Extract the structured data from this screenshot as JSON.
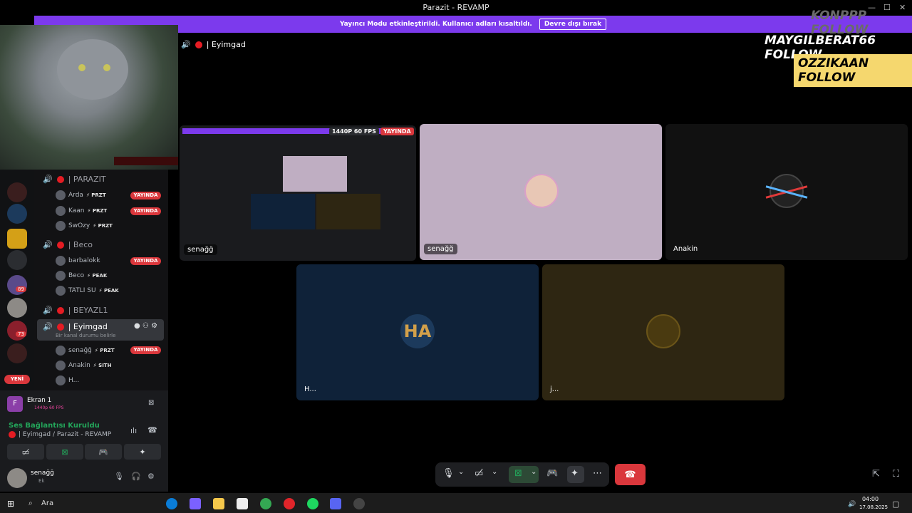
{
  "window": {
    "title": "Parazit - REVAMP",
    "controls": [
      "—",
      "☐",
      "✕"
    ]
  },
  "banner": {
    "text": "Yayıncı Modu etkinleştirildi. Kullanıcı adları kısaltıldı.",
    "button": "Devre dışı bırak"
  },
  "overlay": {
    "lines": [
      "KONPPP FOLLOW",
      "MAYGILBERAT66 FOLLOW",
      "OZZIKAAN FOLLOW"
    ]
  },
  "call": {
    "channel_name": "| Eyimgad"
  },
  "guild_badges": {
    "b1": "89",
    "b2": "73",
    "new": "YENİ"
  },
  "channels": [
    {
      "name": "| PARAZIT",
      "users": [
        {
          "name": "Arda",
          "tag": "⚡ PRZT",
          "live": "YAYINDA"
        },
        {
          "name": "Kaan",
          "tag": "⚡ PRZT",
          "live": "YAYINDA"
        },
        {
          "name": "SwOzy",
          "tag": "⚡ PRZT",
          "live": ""
        }
      ]
    },
    {
      "name": "| Beco",
      "users": [
        {
          "name": "barbalokk",
          "tag": "",
          "live": "YAYINDA"
        },
        {
          "name": "Beco",
          "tag": "⚡ PEAK",
          "live": ""
        },
        {
          "name": "TATLI SU",
          "tag": "⚡ PEAK",
          "live": ""
        }
      ]
    },
    {
      "name": "| BEYAZL1",
      "users": []
    },
    {
      "name": "| Eyimgad",
      "status": "Bir kanal durumu belirle",
      "users": [
        {
          "name": "senağğ",
          "tag": "⚡ PRZT",
          "live": "YAYINDA"
        },
        {
          "name": "Anakin",
          "tag": "⚡ SITH",
          "live": ""
        },
        {
          "name": "H...",
          "tag": "",
          "live": ""
        }
      ]
    }
  ],
  "stream_panel": {
    "title": "Ekran 1",
    "subtitle": "1440p 60 FPS"
  },
  "voice": {
    "status": "Ses Bağlantısı Kuruldu",
    "channel": "| Eyimgad / Parazit - REVAMP"
  },
  "user_panel": {
    "name": "senağğ",
    "sub": "Ek"
  },
  "tiles": [
    {
      "label": "senağğ",
      "badge_quality": "1440P 60 FPS",
      "badge_live": "YAYINDA"
    },
    {
      "label": "senağğ"
    },
    {
      "label": "Anakin"
    },
    {
      "label": "H..."
    },
    {
      "label": "j..."
    }
  ],
  "taskbar": {
    "search": "Ara",
    "time": "04:00",
    "date": "17.08.2025"
  },
  "colors": {
    "accent": "#7c3aed",
    "live": "#da373c",
    "tile1": "#bfaec2",
    "tile_h": "#0f2239",
    "tile_j": "#2e2612"
  }
}
